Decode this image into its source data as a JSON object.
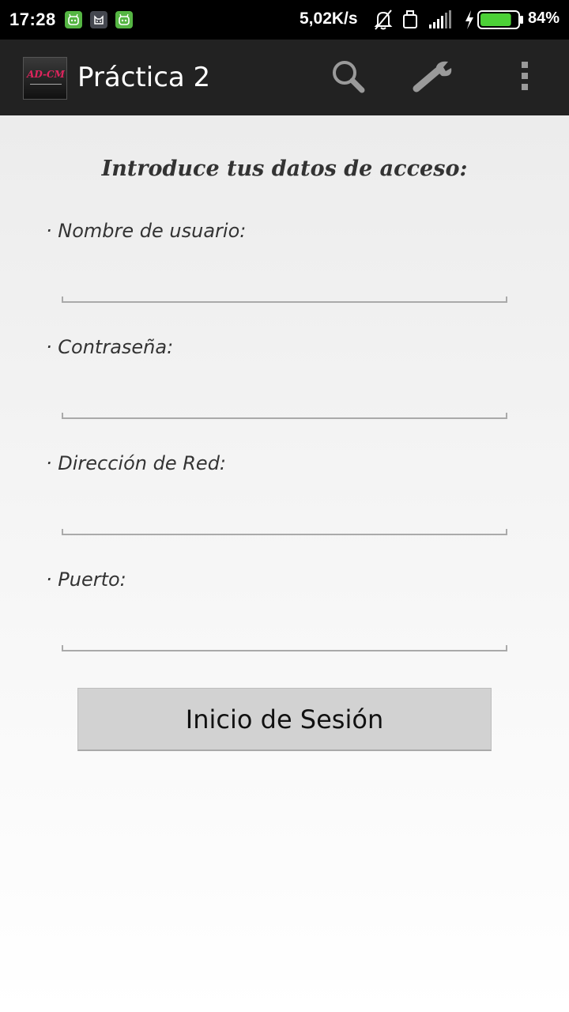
{
  "status_bar": {
    "time": "17:28",
    "notification_icons": [
      "android-icon",
      "cat-icon",
      "android-icon"
    ],
    "network_speed": "5,02K/s",
    "battery_percent": "84%",
    "battery_level": 0.84,
    "battery_color": "#4cd137"
  },
  "action_bar": {
    "logo_text": "AD-CM",
    "title": "Práctica 2",
    "actions": [
      "search-icon",
      "wrench-icon",
      "overflow-menu-icon"
    ]
  },
  "form": {
    "heading": "Introduce tus datos de acceso:",
    "fields": [
      {
        "label": "· Nombre de usuario:",
        "value": ""
      },
      {
        "label": "· Contraseña:",
        "value": ""
      },
      {
        "label": "· Dirección de Red:",
        "value": ""
      },
      {
        "label": "· Puerto:",
        "value": ""
      }
    ],
    "submit_label": "Inicio de Sesión"
  }
}
